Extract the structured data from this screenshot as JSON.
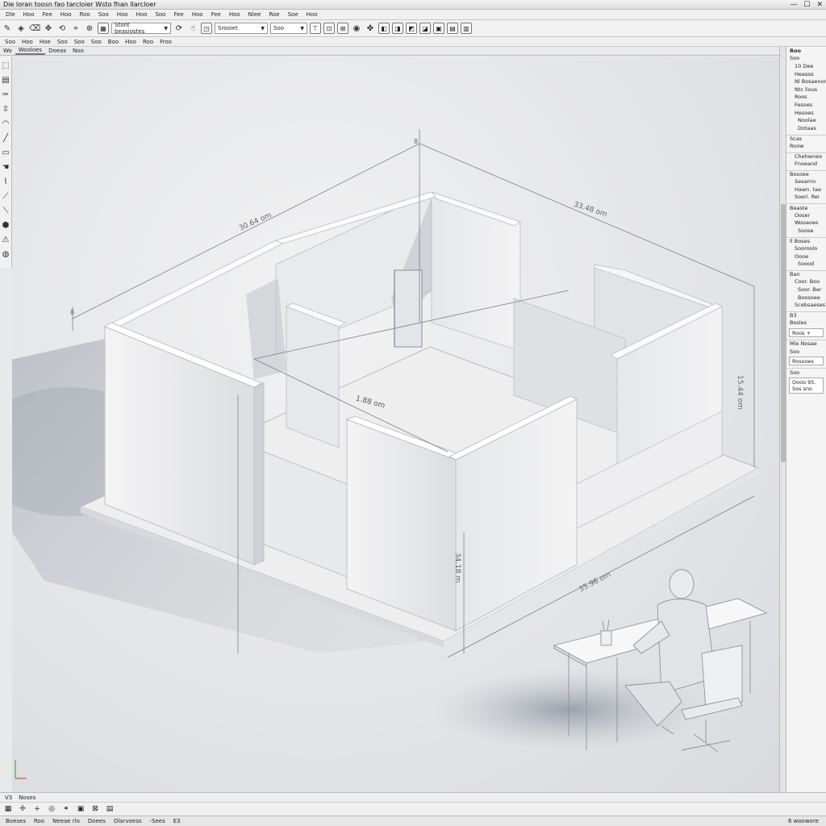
{
  "window": {
    "title": "Die loran toosn fao tarcloier Wsto fhan llarcloer",
    "controls": [
      "—",
      "☐",
      "✕"
    ]
  },
  "menubar": [
    "Dle",
    "Hoo",
    "Fee",
    "Hoo",
    "Roo",
    "Soo",
    "Hoo",
    "Hoo",
    "Soo",
    "Fee",
    "Hoo",
    "Fee",
    "Hoo",
    "Nlee",
    "Roe",
    "Soe",
    "Hoo"
  ],
  "toolbar": {
    "combo1": "Stont beasiostes",
    "combo2": "Srooiet",
    "combo3": "Soo"
  },
  "toolbar2": [
    "Soo",
    "Hoo",
    "Hoe",
    "Soo",
    "Soo",
    "Soo",
    "Boo",
    "Hoo",
    "Roo",
    "Froo"
  ],
  "tabs": [
    "Wo",
    "Wooloes",
    "Doeas",
    "Noo"
  ],
  "dimensions": {
    "left_top": "30.64 om",
    "right_top": "33.48 om",
    "vertical_right": "15.44 om",
    "door": "1.88 om",
    "front_vertical": "34.18 m",
    "front_bottom": "35.96 om",
    "corner_top": "8",
    "corner_left": "8"
  },
  "right_panel": {
    "header": "Roo",
    "rows": [
      {
        "t": "Soo",
        "c": ""
      },
      {
        "t": "10 Dee",
        "c": "indent1"
      },
      {
        "t": "Heasos",
        "c": "indent1"
      },
      {
        "t": "Nl Bosaenor",
        "c": "indent1"
      },
      {
        "t": "Ntc lious",
        "c": "indent1"
      },
      {
        "t": "Roos",
        "c": "indent1"
      },
      {
        "t": "Fesoes",
        "c": "indent1"
      },
      {
        "t": "Hesoes",
        "c": "indent1"
      },
      {
        "t": "Noolae",
        "c": "indent2"
      },
      {
        "t": "Dotaas",
        "c": "indent2"
      },
      {
        "t": "Scas",
        "c": "sect"
      },
      {
        "t": "Roow",
        "c": ""
      },
      {
        "t": "Chehwneo",
        "c": "sect indent1"
      },
      {
        "t": "Fnoeand",
        "c": "indent1"
      },
      {
        "t": "Bosoee",
        "c": "sect"
      },
      {
        "t": "Sesarnn",
        "c": "indent1"
      },
      {
        "t": "Hawn. tae",
        "c": "indent1"
      },
      {
        "t": "Soeri. Rei",
        "c": "indent1"
      },
      {
        "t": "Beaste",
        "c": "sect"
      },
      {
        "t": "Ooser",
        "c": "indent1"
      },
      {
        "t": "Wooaoes",
        "c": "indent1"
      },
      {
        "t": "Soose",
        "c": "indent2"
      },
      {
        "t": "Il Boses",
        "c": "sect"
      },
      {
        "t": "Soomolo",
        "c": "indent1"
      },
      {
        "t": "Oooe",
        "c": "indent1"
      },
      {
        "t": "Soood",
        "c": "indent2"
      },
      {
        "t": "Ban",
        "c": "sect"
      },
      {
        "t": "Coor. Boo",
        "c": "indent1"
      },
      {
        "t": "Soor. Ber",
        "c": "indent2"
      },
      {
        "t": "Boosoee",
        "c": "indent2"
      },
      {
        "t": "Scebsaeses",
        "c": "indent1"
      },
      {
        "t": "B3",
        "c": "sect"
      },
      {
        "t": "Bosles",
        "c": ""
      }
    ],
    "box1": "Roos +",
    "label2": "Mle Nosae",
    "label3": "Soo",
    "box2": "Rosooes",
    "label4": "Soo",
    "box3": "Oooo 95. Sos sno"
  },
  "bottombar": [
    "V3",
    "Noses"
  ],
  "statusbar": [
    "Boeses",
    "Roo",
    "Neeae rlo",
    "Doees",
    "Olarvoess",
    "-Sees",
    "E3"
  ],
  "status_right": "6 woowore"
}
